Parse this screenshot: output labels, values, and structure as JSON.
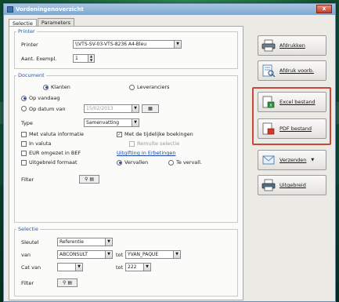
{
  "window": {
    "title": "Vordeningenoverzicht",
    "close_glyph": "x"
  },
  "tabs": [
    {
      "label": "Selectie"
    },
    {
      "label": "Parameters"
    }
  ],
  "printer_group": {
    "title": "Printer",
    "printer_label": "Printer",
    "printer_value": "\\\\VTS-SV-03-VTS-8236 A4-Bleu",
    "copies_label": "Aant. Exempl.",
    "copies_value": "1"
  },
  "document_group": {
    "title": "Document",
    "radio_klanten": "Klanten",
    "radio_leveranciers": "Leveranciers",
    "radio_op_vandaag": "Op vandaag",
    "radio_op_datum": "Op datum van",
    "date_value": "15/02/2013",
    "type_label": "Type",
    "type_value": "Samenvatting",
    "cb_valuta_info": "Met valuta informatie",
    "cb_tijdelijke": "Met de tijdelijke boekingen",
    "cb_in_valuta": "In valuta",
    "cb_remulte": "Remulte selectie",
    "cb_euri": "EUR omgezet in BEF",
    "uitgifte_link": "Uitgifting in Erbetingen",
    "cb_uitgebreid": "Uitgebreid formaat",
    "radio_vervallen": "Vervallen",
    "radio_te_vervall": "Te vervall.",
    "filter_label": "Filter"
  },
  "selectie_group": {
    "title": "Selectie",
    "sleutel_label": "Sleutel",
    "sleutel_value": "Referentie",
    "van_label": "van",
    "van_value": "ABCONSULT",
    "tot_label": "tot",
    "tot_value": "YVAN_PAQUE",
    "cat_label": "Cat van",
    "cat_value": "",
    "cat_tot_label": "tot",
    "cat_tot_value": "222",
    "filter_label": "Filter"
  },
  "side_buttons": {
    "afdrukken": "Afdrukken",
    "afdruk_voorb": "Afdruk voorb.",
    "excel": "Excel bestand",
    "pdf": "PDF bestand",
    "verzenden": "Verzenden",
    "uitgebreid": "Uitgebreid"
  },
  "colors": {
    "accent": "#2a58a8",
    "highlight": "#c9483a",
    "background": "#1f6f42"
  }
}
